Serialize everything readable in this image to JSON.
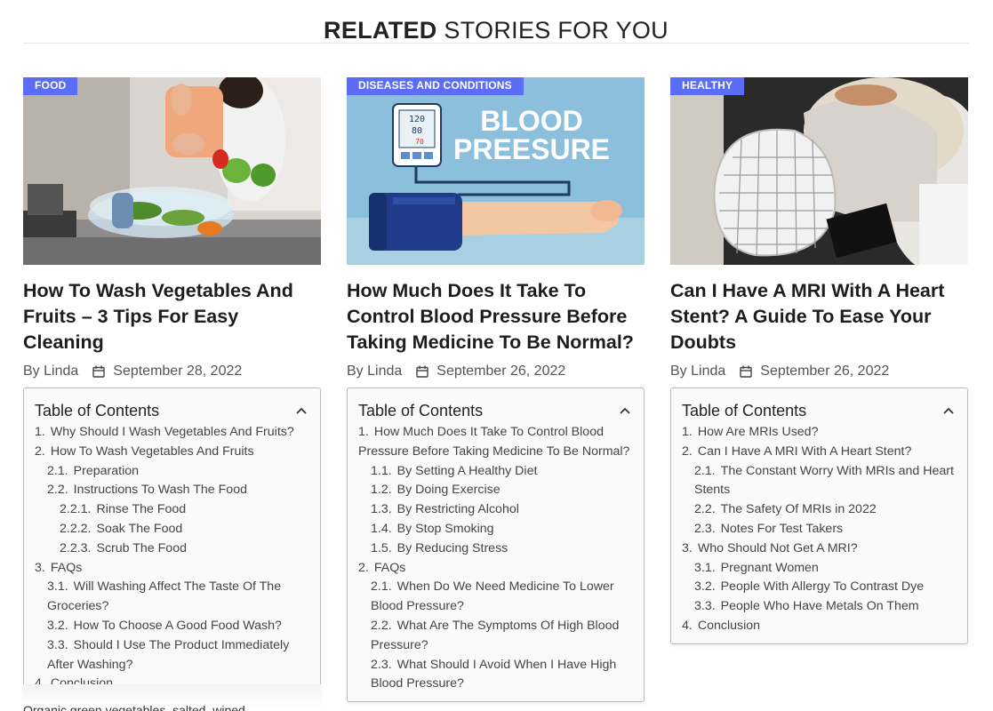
{
  "section": {
    "title_bold": "RELATED",
    "title_light": " STORIES FOR YOU",
    "accent_color": "#d4f53c"
  },
  "badge_color": "#5b6cf5",
  "cards": [
    {
      "category": "FOOD",
      "title": "How To Wash Vegetables And Fruits – 3 Tips For Easy Cleaning",
      "author": "By Linda",
      "date": "September 28, 2022",
      "toc_title": "Table of Contents",
      "toc": [
        {
          "num": "1.",
          "text": "Why Should I Wash Vegetables And Fruits?",
          "level": 1
        },
        {
          "num": "2.",
          "text": "How To Wash Vegetables And Fruits",
          "level": 1
        },
        {
          "num": "2.1.",
          "text": "Preparation",
          "level": 2
        },
        {
          "num": "2.2.",
          "text": "Instructions To Wash The Food",
          "level": 2
        },
        {
          "num": "2.2.1.",
          "text": "Rinse The Food",
          "level": 3
        },
        {
          "num": "2.2.2.",
          "text": "Soak The Food",
          "level": 3
        },
        {
          "num": "2.2.3.",
          "text": "Scrub The Food",
          "level": 3
        },
        {
          "num": "3.",
          "text": "FAQs",
          "level": 1
        },
        {
          "num": "3.1.",
          "text": "Will Washing Affect The Taste Of The Groceries?",
          "level": 2
        },
        {
          "num": "3.2.",
          "text": "How To Choose A Good Food Wash?",
          "level": 2
        },
        {
          "num": "3.3.",
          "text": "Should I Use The Product Immediately After Washing?",
          "level": 2
        },
        {
          "num": "4.",
          "text": "Conclusion",
          "level": 1
        }
      ]
    },
    {
      "category": "DISEASES AND CONDITIONS",
      "title": "How Much Does It Take To Control Blood Pressure Before Taking Medicine To Be Normal?",
      "author": "By Linda",
      "date": "September 26, 2022",
      "image_text_line1": "BLOOD",
      "image_text_line2": "PREESURE",
      "monitor_readings": [
        "120",
        "80",
        "70"
      ],
      "toc_title": "Table of Contents",
      "toc": [
        {
          "num": "1.",
          "text": "How Much Does It Take To Control Blood Pressure Before Taking Medicine To Be Normal?",
          "level": 1
        },
        {
          "num": "1.1.",
          "text": "By Setting A Healthy Diet",
          "level": 2
        },
        {
          "num": "1.2.",
          "text": "By Doing Exercise",
          "level": 2
        },
        {
          "num": "1.3.",
          "text": "By Restricting Alcohol",
          "level": 2
        },
        {
          "num": "1.4.",
          "text": "By Stop Smoking",
          "level": 2
        },
        {
          "num": "1.5.",
          "text": "By Reducing Stress",
          "level": 2
        },
        {
          "num": "2.",
          "text": "FAQs",
          "level": 1
        },
        {
          "num": "2.1.",
          "text": "When Do We Need Medicine To Lower Blood Pressure?",
          "level": 2
        },
        {
          "num": "2.2.",
          "text": "What Are The Symptoms Of High Blood Pressure?",
          "level": 2
        },
        {
          "num": "2.3.",
          "text": "What Should I Avoid When I Have High Blood Pressure?",
          "level": 2
        }
      ]
    },
    {
      "category": "HEALTHY",
      "title": "Can I Have A MRI With A Heart Stent? A Guide To Ease Your Doubts",
      "author": "By Linda",
      "date": "September 26, 2022",
      "toc_title": "Table of Contents",
      "toc": [
        {
          "num": "1.",
          "text": "How Are MRIs Used?",
          "level": 1
        },
        {
          "num": "2.",
          "text": "Can I Have A MRI With A Heart Stent?",
          "level": 1
        },
        {
          "num": "2.1.",
          "text": "The Constant Worry With MRIs and Heart Stents",
          "level": 2
        },
        {
          "num": "2.2.",
          "text": "The Safety Of MRIs in 2022",
          "level": 2
        },
        {
          "num": "2.3.",
          "text": "Notes For Test Takers",
          "level": 2
        },
        {
          "num": "3.",
          "text": "Who Should Not Get A MRI?",
          "level": 1
        },
        {
          "num": "3.1.",
          "text": "Pregnant Women",
          "level": 2
        },
        {
          "num": "3.2.",
          "text": "People With Allergy To Contrast Dye",
          "level": 2
        },
        {
          "num": "3.3.",
          "text": "People Who Have Metals On Them",
          "level": 2
        },
        {
          "num": "4.",
          "text": "Conclusion",
          "level": 1
        }
      ]
    }
  ],
  "bottom_snippet": "Organic green vegetables, salted, wiped"
}
